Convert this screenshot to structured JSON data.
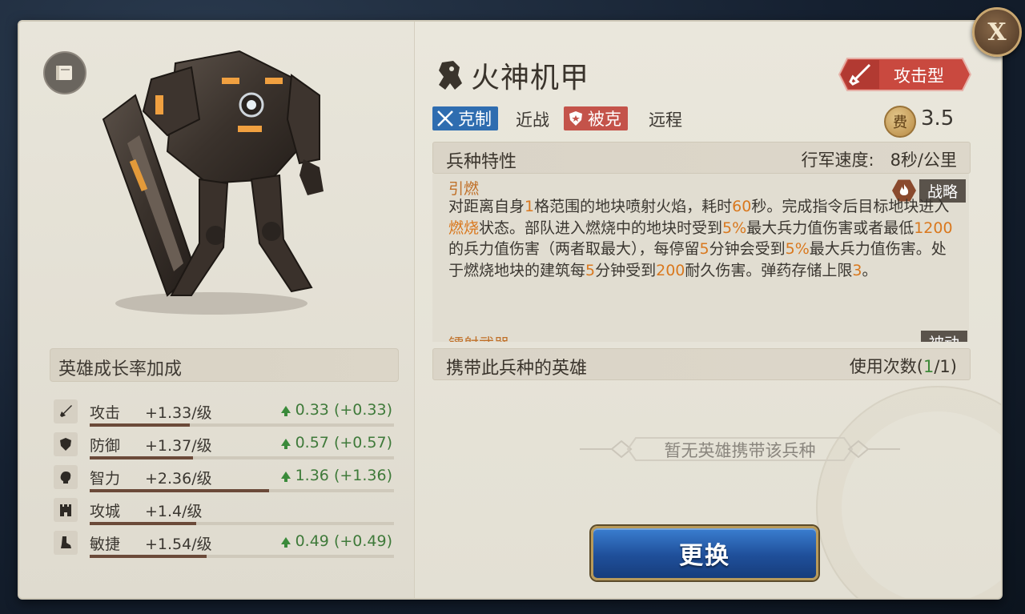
{
  "unit": {
    "name": "火神机甲",
    "type_label": "攻击型",
    "counters_label": "克制",
    "counters_target": "近战",
    "countered_label": "被克",
    "countered_by": "远程",
    "cost_icon": "费",
    "cost": "3.5"
  },
  "traits": {
    "header": "兵种特性",
    "march_speed_label": "行军速度:",
    "march_speed_value": "8秒/公里",
    "items": [
      {
        "name": "引燃",
        "tag": "战略"
      },
      {
        "name": "镭射武器",
        "tag": "被动"
      }
    ]
  },
  "heroes": {
    "header": "携带此兵种的英雄",
    "usage_label": "使用次数(",
    "usage_used": "1",
    "usage_total": "/1)",
    "empty_text": "暂无英雄携带该兵种"
  },
  "growth": {
    "header": "英雄成长率加成",
    "stats": [
      {
        "name": "攻击",
        "rate": "+1.33/级",
        "gain": "0.33 (+0.33)",
        "fill": 0.33,
        "icon": "sword-icon"
      },
      {
        "name": "防御",
        "rate": "+1.37/级",
        "gain": "0.57 (+0.57)",
        "fill": 0.34,
        "icon": "shield-icon"
      },
      {
        "name": "智力",
        "rate": "+2.36/级",
        "gain": "1.36 (+1.36)",
        "fill": 0.59,
        "icon": "brain-icon"
      },
      {
        "name": "攻城",
        "rate": "+1.4/级",
        "gain": "",
        "fill": 0.35,
        "icon": "castle-icon"
      },
      {
        "name": "敏捷",
        "rate": "+1.54/级",
        "gain": "0.49 (+0.49)",
        "fill": 0.385,
        "icon": "boot-icon"
      }
    ]
  },
  "buttons": {
    "replace": "更换",
    "close": "X"
  },
  "colors": {
    "highlight": "#d9781e",
    "counter_blue": "#2f6db0",
    "countered_red": "#c4534a",
    "type_badge": "#c9493f",
    "gain_green": "#3f7a3a"
  }
}
